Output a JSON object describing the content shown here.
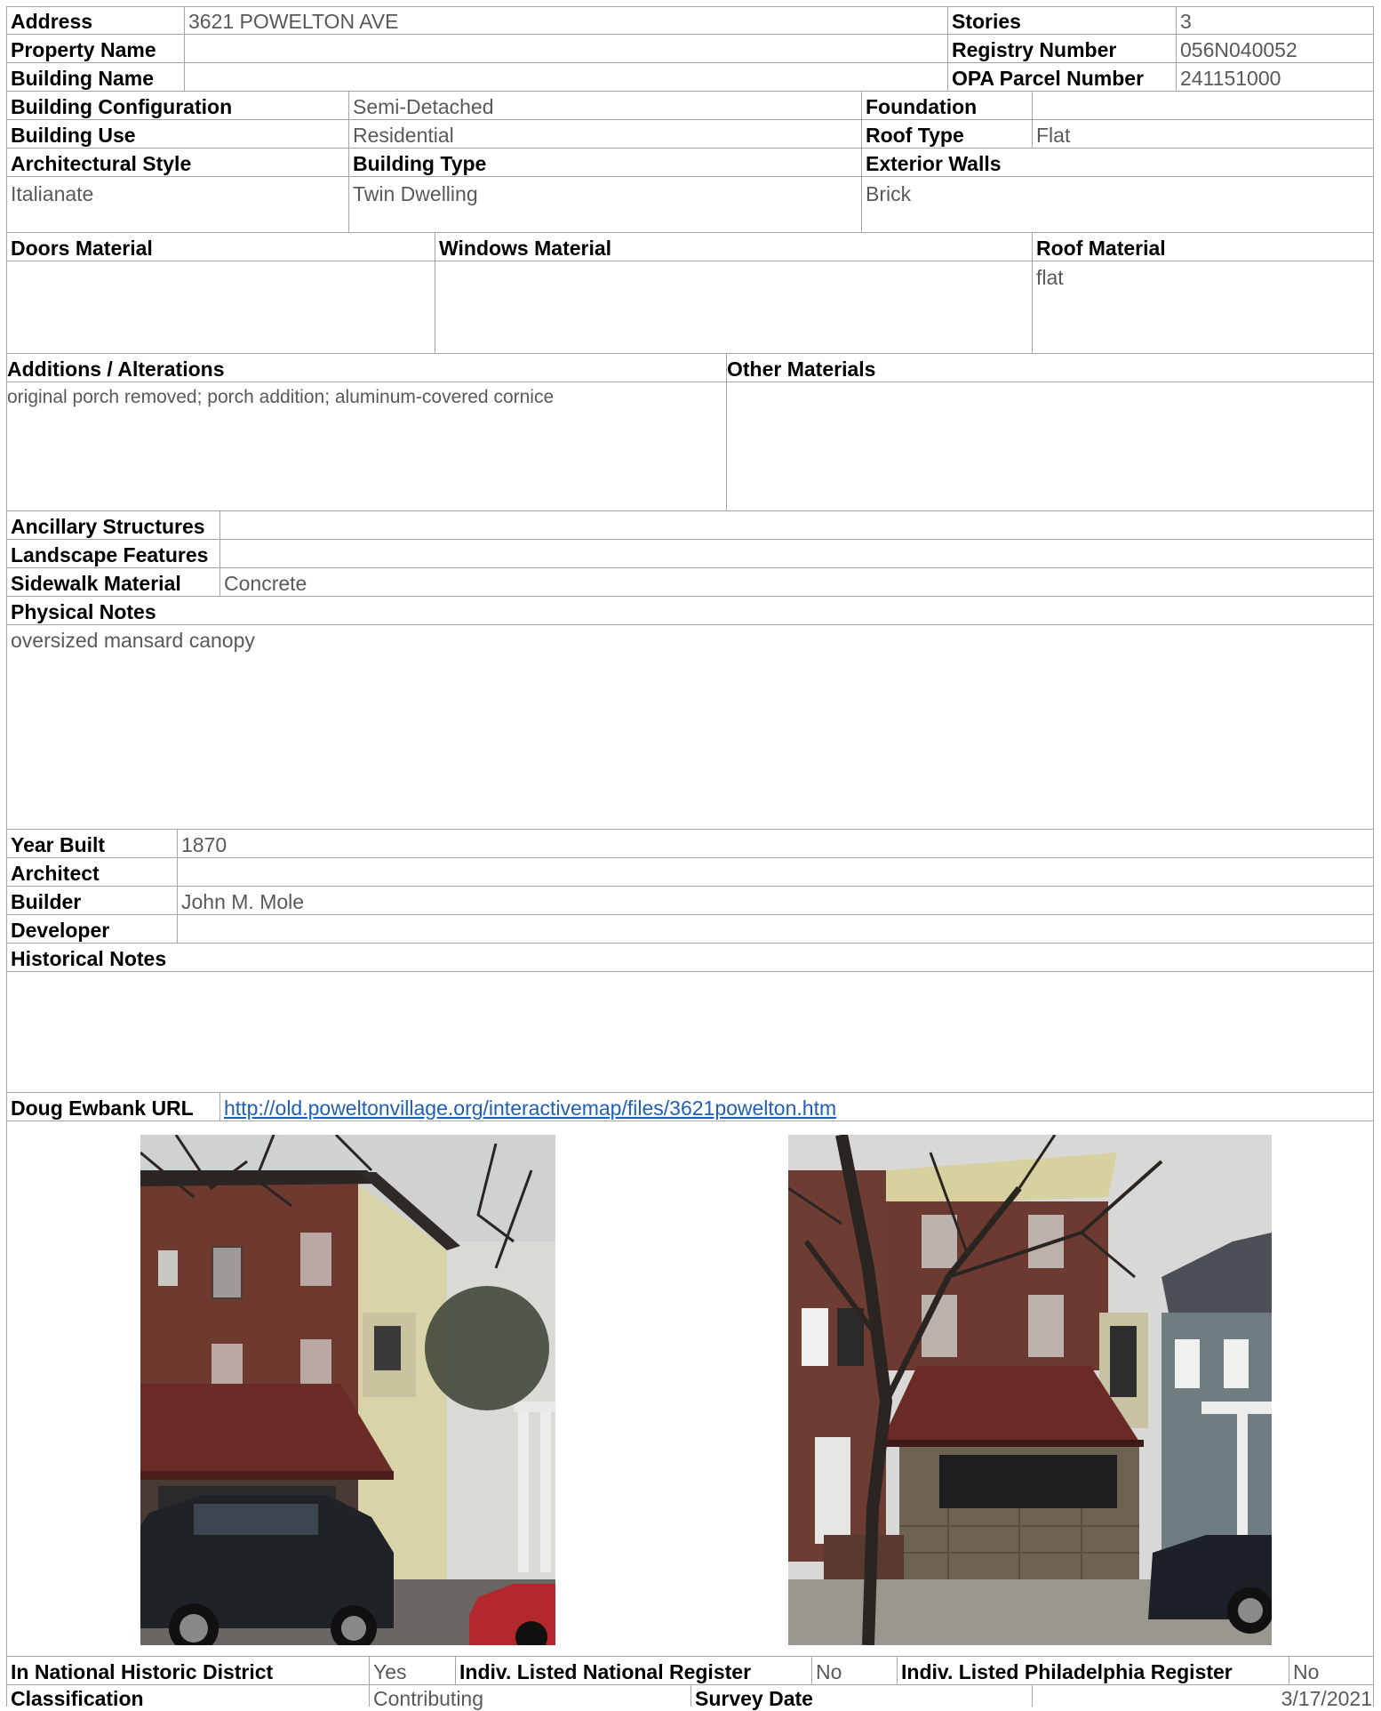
{
  "row1": {
    "address_label": "Address",
    "address_value": "3621 POWELTON AVE",
    "stories_label": "Stories",
    "stories_value": "3"
  },
  "row2": {
    "property_name_label": "Property Name",
    "property_name_value": "",
    "registry_label": "Registry Number",
    "registry_value": "056N040052"
  },
  "row3": {
    "building_name_label": "Building Name",
    "building_name_value": "",
    "opa_label": "OPA Parcel Number",
    "opa_value": "241151000"
  },
  "config": {
    "configuration_label": "Building Configuration",
    "configuration_value": "Semi-Detached",
    "foundation_label": "Foundation",
    "foundation_value": "",
    "use_label": "Building Use",
    "use_value": "Residential",
    "roof_type_label": "Roof Type",
    "roof_type_value": "Flat",
    "arch_style_label": "Architectural Style",
    "arch_style_value": "Italianate",
    "building_type_label": "Building Type",
    "building_type_value": "Twin Dwelling",
    "exterior_walls_label": "Exterior Walls",
    "exterior_walls_value": "Brick"
  },
  "materials": {
    "doors_label": "Doors Material",
    "doors_value": "",
    "windows_label": "Windows Material",
    "windows_value": "",
    "roof_label": "Roof Material",
    "roof_value": "flat"
  },
  "alterations": {
    "additions_label": "Additions / Alterations",
    "additions_value": "original porch removed; porch addition; aluminum-covered cornice",
    "other_label": "Other Materials",
    "other_value": ""
  },
  "site": {
    "ancillary_label": "Ancillary Structures",
    "ancillary_value": "",
    "landscape_label": "Landscape Features",
    "landscape_value": "",
    "sidewalk_label": "Sidewalk Material",
    "sidewalk_value": "Concrete"
  },
  "physical_notes": {
    "label": "Physical Notes",
    "value": "oversized mansard canopy"
  },
  "history": {
    "year_label": "Year Built",
    "year_value": "1870",
    "architect_label": "Architect",
    "architect_value": "",
    "builder_label": "Builder",
    "builder_value": "John M. Mole",
    "developer_label": "Developer",
    "developer_value": "",
    "notes_label": "Historical Notes",
    "notes_value": ""
  },
  "url": {
    "label": "Doug Ewbank URL",
    "value": "http://old.poweltonvillage.org/interactivemap/files/3621powelton.htm"
  },
  "status": {
    "district_label": "In National Historic District",
    "district_value": "Yes",
    "national_label": "Indiv. Listed National Register",
    "national_value": "No",
    "philly_label": "Indiv. Listed Philadelphia Register",
    "philly_value": "No",
    "classification_label": "Classification",
    "classification_value": "Contributing",
    "survey_label": "Survey Date",
    "survey_value": "3/17/2021"
  },
  "colors": {
    "label_text": "#000000",
    "value_text": "#595959",
    "grid_line": "#a6a6a6",
    "link": "#1f5fb5"
  }
}
